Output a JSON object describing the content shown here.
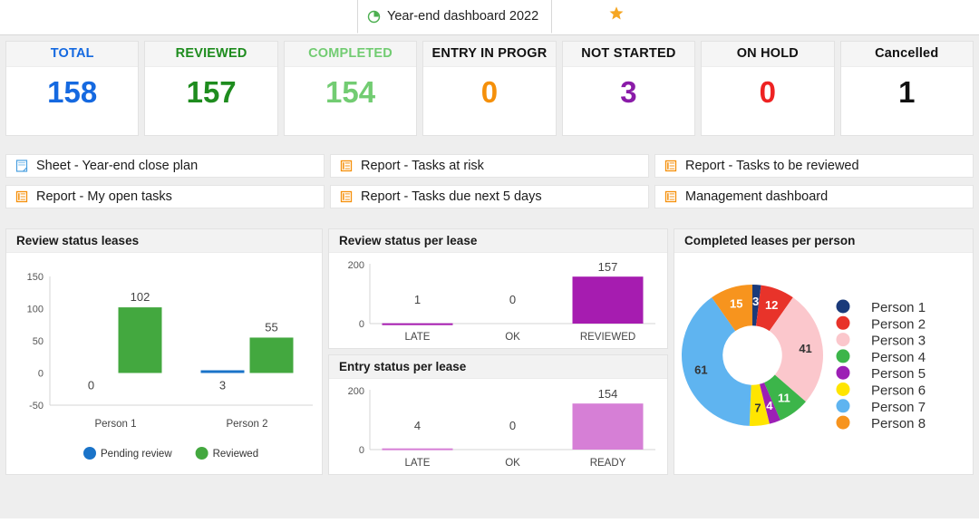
{
  "tab": {
    "title": "Year-end dashboard 2022",
    "icon": "pie-chart-icon",
    "favorite_icon": "star-icon"
  },
  "kpis": [
    {
      "label": "TOTAL",
      "value": "158",
      "label_color": "#1569e0",
      "value_color": "#1569e0"
    },
    {
      "label": "REVIEWED",
      "value": "157",
      "label_color": "#1e8c1e",
      "value_color": "#1e8c1e"
    },
    {
      "label": "COMPLETED",
      "value": "154",
      "label_color": "#72cc72",
      "value_color": "#72cc72"
    },
    {
      "label": "ENTRY IN PROGR",
      "value": "0",
      "label_color": "#111111",
      "value_color": "#f5900a"
    },
    {
      "label": "NOT STARTED",
      "value": "3",
      "label_color": "#111111",
      "value_color": "#8a1ba8"
    },
    {
      "label": "ON HOLD",
      "value": "0",
      "label_color": "#111111",
      "value_color": "#ee2222"
    },
    {
      "label": "Cancelled",
      "value": "1",
      "label_color": "#111111",
      "value_color": "#111111"
    }
  ],
  "links": {
    "col1": [
      {
        "label": "Sheet - Year-end close plan",
        "icon": "sheet-icon",
        "icon_color": "#4a9fe0"
      },
      {
        "label": "Report - My open tasks",
        "icon": "report-icon",
        "icon_color": "#f5900a"
      }
    ],
    "col2": [
      {
        "label": "Report - Tasks at risk",
        "icon": "report-icon",
        "icon_color": "#f5900a"
      },
      {
        "label": "Report - Tasks due next 5 days",
        "icon": "report-icon",
        "icon_color": "#f5900a"
      }
    ],
    "col3": [
      {
        "label": "Report - Tasks to be reviewed",
        "icon": "report-icon",
        "icon_color": "#f5900a"
      },
      {
        "label": "Management dashboard",
        "icon": "report-icon",
        "icon_color": "#f5900a"
      }
    ]
  },
  "panels": {
    "review_status_leases": "Review status leases",
    "review_status_per_lease": "Review status per lease",
    "entry_status_per_lease": "Entry status per lease",
    "completed_leases_per_person": "Completed leases per person"
  },
  "chart_data": [
    {
      "id": "review-status-leases",
      "type": "bar",
      "title": "Review status leases",
      "categories": [
        "Person 1",
        "Person 2"
      ],
      "series": [
        {
          "name": "Pending review",
          "values": [
            0,
            3
          ],
          "color": "#1a73c8"
        },
        {
          "name": "Reviewed",
          "values": [
            102,
            55
          ],
          "color": "#43a83f"
        }
      ],
      "ylim": [
        -50,
        150
      ],
      "yticks": [
        "150",
        "100",
        "50",
        "0",
        "-50"
      ],
      "xlabel": "",
      "ylabel": "",
      "grid": false,
      "legend": "bottom",
      "datalabels": [
        "0",
        "102",
        "3",
        "55"
      ]
    },
    {
      "id": "review-status-per-lease",
      "type": "bar",
      "title": "Review status per lease",
      "categories": [
        "LATE",
        "OK",
        "REVIEWED"
      ],
      "values": [
        1,
        0,
        157
      ],
      "color": "#a61cb0",
      "ylim": [
        0,
        200
      ],
      "yticks": [
        "200",
        "0"
      ],
      "grid": false,
      "legend": "none",
      "datalabels": [
        "1",
        "0",
        "157"
      ]
    },
    {
      "id": "entry-status-per-lease",
      "type": "bar",
      "title": "Entry status per lease",
      "categories": [
        "LATE",
        "OK",
        "READY"
      ],
      "values": [
        4,
        0,
        154
      ],
      "color": "#d67fd6",
      "ylim": [
        0,
        200
      ],
      "yticks": [
        "200",
        "0"
      ],
      "grid": false,
      "legend": "none",
      "datalabels": [
        "4",
        "0",
        "154"
      ]
    },
    {
      "id": "completed-leases-per-person",
      "type": "pie",
      "title": "Completed leases per person",
      "labels": [
        "Person 1",
        "Person 2",
        "Person 3",
        "Person 4",
        "Person 5",
        "Person 6",
        "Person 7",
        "Person 8"
      ],
      "values": [
        3,
        12,
        41,
        11,
        4,
        7,
        61,
        15
      ],
      "colors": [
        "#1a3a7a",
        "#e8332a",
        "#fbc7cc",
        "#3cb54a",
        "#9c1fb5",
        "#ffe500",
        "#5fb4f0",
        "#f7941e"
      ],
      "label_text_colors": [
        "#ffffff",
        "#ffffff",
        "#333333",
        "#ffffff",
        "#ffffff",
        "#333333",
        "#333333",
        "#ffffff"
      ],
      "total": 154,
      "donut": true,
      "hole_ratio": 0.42,
      "legend": "right"
    }
  ]
}
